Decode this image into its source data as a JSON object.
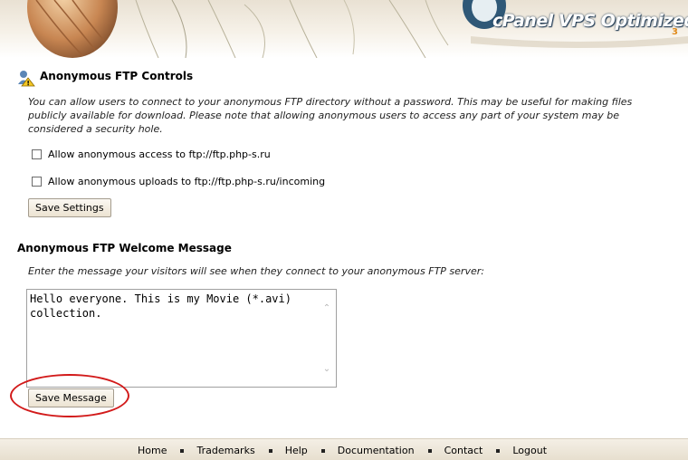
{
  "header": {
    "brand": "cPanel VPS Optimized",
    "brand_prefix": "cPanel",
    "brand_suffix": "VPS Optimized",
    "version_mark": "3"
  },
  "ftp_controls": {
    "title": "Anonymous FTP Controls",
    "icon": "ftp-user-warning-icon",
    "description": "You can allow users to connect to your anonymous FTP directory without a password. This may be useful for making files publicly available for download. Please note that allowing anonymous users to access any part of your system may be considered a security hole.",
    "options": [
      {
        "label": "Allow anonymous access to ftp://ftp.php-s.ru",
        "checked": false
      },
      {
        "label": "Allow anonymous uploads to ftp://ftp.php-s.ru/incoming",
        "checked": false
      }
    ],
    "save_label": "Save Settings"
  },
  "welcome": {
    "title": "Anonymous FTP Welcome Message",
    "description": "Enter the message your visitors will see when they connect to your anonymous FTP server:",
    "message": "Hello everyone. This is my Movie (*.avi) collection.",
    "save_label": "Save Message"
  },
  "footer": {
    "links": [
      "Home",
      "Trademarks",
      "Help",
      "Documentation",
      "Contact",
      "Logout"
    ]
  },
  "colors": {
    "highlight": "#d21a1a",
    "button_bg": "#ece3d2",
    "footer_bg": "#e7dfcf"
  }
}
